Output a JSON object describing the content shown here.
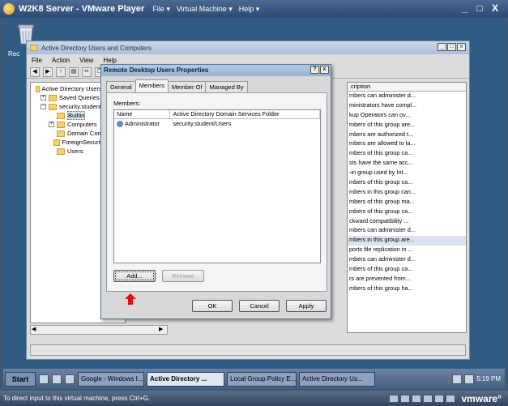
{
  "player": {
    "title": "W2K8 Server - VMware Player",
    "menus": [
      "File ▾",
      "Virtual Machine ▾",
      "Help ▾"
    ],
    "window_controls": "_ □ X",
    "status_text": "To direct input to this virtual machine, press Ctrl+G.",
    "brand": "vmware°"
  },
  "desktop": {
    "recycle_label": "Rec"
  },
  "aduc": {
    "title": "Active Directory Users and Computers",
    "menus": [
      "File",
      "Action",
      "View",
      "Help"
    ],
    "tree": [
      {
        "label": "Active Directory Users and Co",
        "pm": "",
        "indent": 0
      },
      {
        "label": "Saved Queries",
        "pm": "+",
        "indent": 1
      },
      {
        "label": "security.student",
        "pm": "−",
        "indent": 1
      },
      {
        "label": "Builtin",
        "pm": "",
        "indent": 2,
        "selected": true
      },
      {
        "label": "Computers",
        "pm": "+",
        "indent": 2
      },
      {
        "label": "Domain Controllers",
        "pm": "",
        "indent": 2
      },
      {
        "label": "ForeignSecurityPrincip",
        "pm": "",
        "indent": 2
      },
      {
        "label": "Users",
        "pm": "",
        "indent": 2
      }
    ],
    "list_header": "cription",
    "list_rows": [
      "mbers can administer d...",
      "ministrators have compl...",
      "kup Operators can ov...",
      "mbers of this group are...",
      "mbers are authorized t...",
      "mbers are allowed to la...",
      "mbers of this group ca...",
      "sts have the same acc...",
      "-in group used by Int...",
      "mbers of this group ca...",
      "mbers in this group can...",
      "mbers of this group ma...",
      "mbers of this group ca...",
      "ckward compatibility ...",
      "mbers can administer d...",
      "mbers in this group are...",
      "ports file replication in ...",
      "mbers can administer d...",
      "mbers of this group ca...",
      "rs are prevented from...",
      "mbers of this group ha..."
    ]
  },
  "dialog": {
    "title": "Remote Desktop Users Properties",
    "tabs": [
      "General",
      "Members",
      "Member Of",
      "Managed By"
    ],
    "members_label": "Members:",
    "columns": [
      "Name",
      "Active Directory Domain Services Folder"
    ],
    "rows": [
      {
        "name": "Administrator",
        "folder": "security.student/Users"
      }
    ],
    "add_label": "Add...",
    "remove_label": "Remove",
    "ok_label": "OK",
    "cancel_label": "Cancel",
    "apply_label": "Apply"
  },
  "taskbar": {
    "start_label": "Start",
    "tasks": [
      {
        "label": "Google - Windows I...",
        "active": false
      },
      {
        "label": "Active Directory ...",
        "active": true
      },
      {
        "label": "Local Group Policy E...",
        "active": false
      },
      {
        "label": "Active Directory Us...",
        "active": false
      }
    ],
    "clock": "5:19 PM"
  },
  "colors": {
    "accent": "#e01010",
    "selection": "#d9e4f0"
  }
}
